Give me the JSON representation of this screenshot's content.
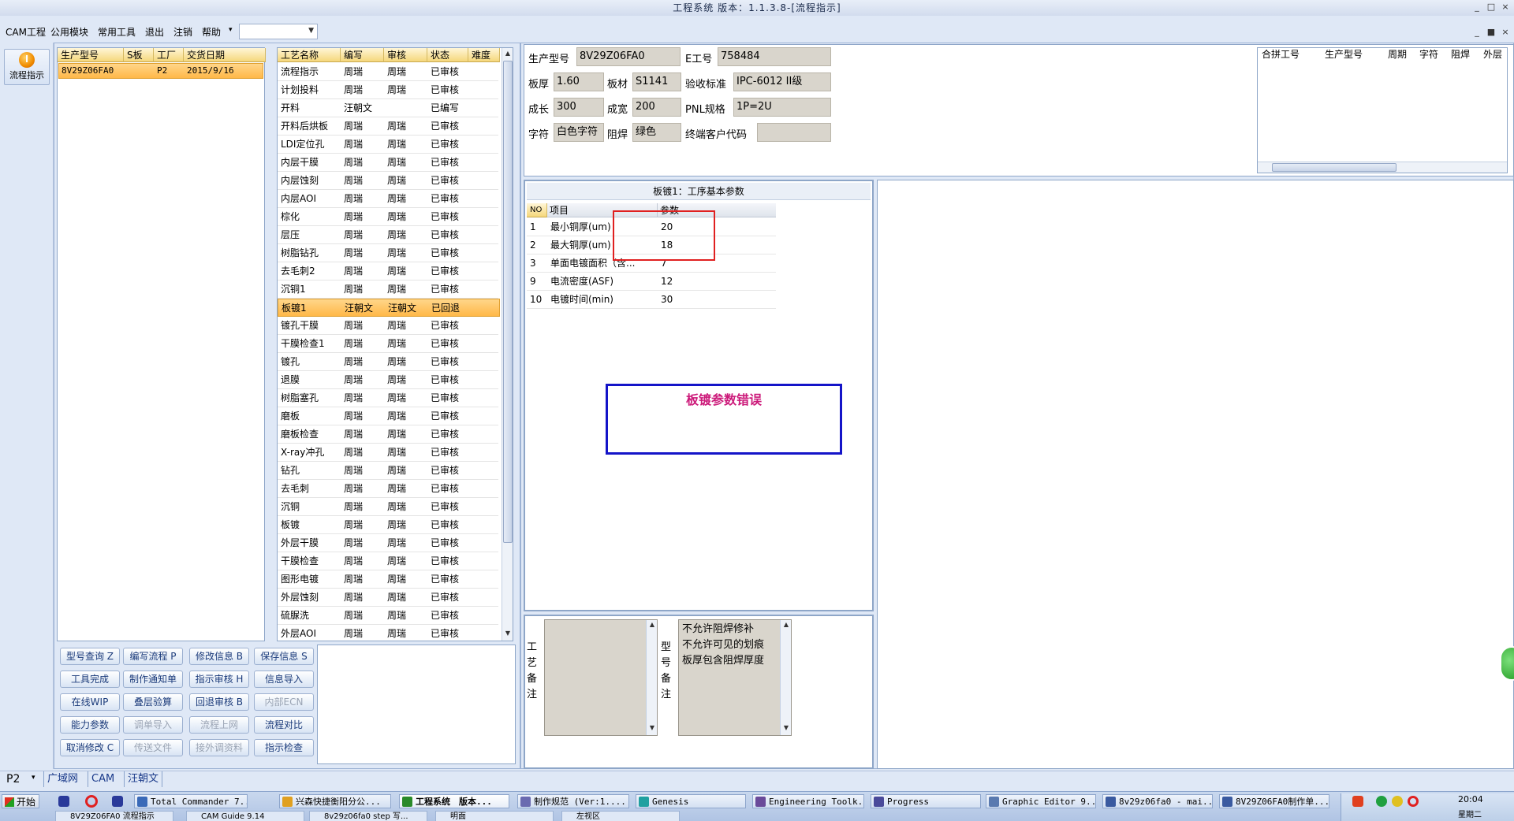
{
  "window": {
    "title": "工程系统 版本：1.1.3.8-[流程指示]",
    "controls": [
      "_",
      "□",
      "×"
    ],
    "mdi_controls": [
      "_",
      "■",
      "×"
    ]
  },
  "menu": {
    "items": [
      "CAM工程",
      "公用模块",
      "常用工具",
      "退出",
      "注销",
      "帮助"
    ],
    "help_arrow": "▾",
    "combo_value": ""
  },
  "left_strip": {
    "flow_button": "流程指示"
  },
  "model_list": {
    "headers": [
      "生产型号",
      "S板",
      "工厂",
      "交货日期"
    ],
    "rows": [
      {
        "model": "8V29Z06FA0",
        "s": "",
        "factory": "P2",
        "date": "2015/9/16"
      }
    ]
  },
  "process_list": {
    "headers": [
      "工艺名称",
      "编写",
      "审核",
      "状态",
      "难度"
    ],
    "rows": [
      [
        "流程指示",
        "周瑞",
        "周瑞",
        "已审核"
      ],
      [
        "计划投料",
        "周瑞",
        "周瑞",
        "已审核"
      ],
      [
        "开料",
        "汪朝文",
        "",
        "已编写"
      ],
      [
        "开料后烘板",
        "周瑞",
        "周瑞",
        "已审核"
      ],
      [
        "LDI定位孔",
        "周瑞",
        "周瑞",
        "已审核"
      ],
      [
        "内层干膜",
        "周瑞",
        "周瑞",
        "已审核"
      ],
      [
        "内层蚀刻",
        "周瑞",
        "周瑞",
        "已审核"
      ],
      [
        "内层AOI",
        "周瑞",
        "周瑞",
        "已审核"
      ],
      [
        "棕化",
        "周瑞",
        "周瑞",
        "已审核"
      ],
      [
        "层压",
        "周瑞",
        "周瑞",
        "已审核"
      ],
      [
        "树脂钻孔",
        "周瑞",
        "周瑞",
        "已审核"
      ],
      [
        "去毛刺2",
        "周瑞",
        "周瑞",
        "已审核"
      ],
      [
        "沉铜1",
        "周瑞",
        "周瑞",
        "已审核"
      ],
      [
        "板镀1",
        "汪朝文",
        "汪朝文",
        "已回退"
      ],
      [
        "镀孔干膜",
        "周瑞",
        "周瑞",
        "已审核"
      ],
      [
        "干膜检查1",
        "周瑞",
        "周瑞",
        "已审核"
      ],
      [
        "镀孔",
        "周瑞",
        "周瑞",
        "已审核"
      ],
      [
        "退膜",
        "周瑞",
        "周瑞",
        "已审核"
      ],
      [
        "树脂塞孔",
        "周瑞",
        "周瑞",
        "已审核"
      ],
      [
        "磨板",
        "周瑞",
        "周瑞",
        "已审核"
      ],
      [
        "磨板检查",
        "周瑞",
        "周瑞",
        "已审核"
      ],
      [
        "X-ray冲孔",
        "周瑞",
        "周瑞",
        "已审核"
      ],
      [
        "钻孔",
        "周瑞",
        "周瑞",
        "已审核"
      ],
      [
        "去毛刺",
        "周瑞",
        "周瑞",
        "已审核"
      ],
      [
        "沉铜",
        "周瑞",
        "周瑞",
        "已审核"
      ],
      [
        "板镀",
        "周瑞",
        "周瑞",
        "已审核"
      ],
      [
        "外层干膜",
        "周瑞",
        "周瑞",
        "已审核"
      ],
      [
        "干膜检查",
        "周瑞",
        "周瑞",
        "已审核"
      ],
      [
        "图形电镀",
        "周瑞",
        "周瑞",
        "已审核"
      ],
      [
        "外层蚀刻",
        "周瑞",
        "周瑞",
        "已审核"
      ],
      [
        "硫脲洗",
        "周瑞",
        "周瑞",
        "已审核"
      ],
      [
        "外层AOI",
        "周瑞",
        "周瑞",
        "已审核"
      ]
    ],
    "selected_index": 13
  },
  "buttons": [
    [
      {
        "label": "型号查询 Z",
        "enabled": true
      },
      {
        "label": "编写流程 P",
        "enabled": true
      },
      {
        "label": "修改信息 B",
        "enabled": true
      },
      {
        "label": "保存信息 S",
        "enabled": true
      }
    ],
    [
      {
        "label": "工具完成",
        "enabled": true
      },
      {
        "label": "制作通知单",
        "enabled": true
      },
      {
        "label": "指示审核 H",
        "enabled": true
      },
      {
        "label": "信息导入",
        "enabled": true
      }
    ],
    [
      {
        "label": "在线WIP",
        "enabled": true
      },
      {
        "label": "叠层验算",
        "enabled": true
      },
      {
        "label": "回退审核 B",
        "enabled": true
      },
      {
        "label": "内部ECN",
        "enabled": false
      }
    ],
    [
      {
        "label": "能力参数",
        "enabled": true
      },
      {
        "label": "调单导入",
        "enabled": false
      },
      {
        "label": "流程上网",
        "enabled": false
      },
      {
        "label": "流程对比",
        "enabled": true
      }
    ],
    [
      {
        "label": "取消修改 C",
        "enabled": true
      },
      {
        "label": "传送文件",
        "enabled": false
      },
      {
        "label": "接外调资料",
        "enabled": false
      },
      {
        "label": "指示检查",
        "enabled": true
      }
    ]
  ],
  "info": {
    "model_label": "生产型号",
    "model": "8V29Z06FA0",
    "eno_label": "E工号",
    "eno": "758484",
    "thick_label": "板厚",
    "thick": "1.60",
    "material_label": "板材",
    "material": "S1141",
    "accept_label": "验收标准",
    "accept": "IPC-6012 II级",
    "len_label": "成长",
    "len": "300",
    "wid_label": "成宽",
    "wid": "200",
    "pnl_label": "PNL规格",
    "pnl": "1P=2U",
    "char_label": "字符",
    "char": "白色字符",
    "mask_label": "阻焊",
    "mask": "绿色",
    "customer_label": "终端客户代码",
    "customer": ""
  },
  "merge_table": {
    "headers": [
      "合拼工号",
      "生产型号",
      "周期",
      "字符",
      "阻焊",
      "外层"
    ]
  },
  "param_panel": {
    "title": "板镀1：工序基本参数",
    "headers": [
      "NO",
      "项目",
      "参数"
    ],
    "rows": [
      [
        "1",
        "最小铜厚(um)",
        "20"
      ],
      [
        "2",
        "最大铜厚(um)",
        "18"
      ],
      [
        "3",
        "单面电镀面积（含...",
        "7"
      ],
      [
        "9",
        "电流密度(ASF)",
        "12"
      ],
      [
        "10",
        "电镀时间(min)",
        "30"
      ]
    ],
    "error": "板镀参数错误",
    "error_color": "#cc1a7a"
  },
  "remarks": {
    "process_label": "工艺备注",
    "model_label": "型号备注",
    "model_notes": [
      "不允许阻焊修补",
      "不允许可见的划痕",
      "板厚包含阻焊厚度"
    ]
  },
  "statusbar": {
    "factory": "P2",
    "items": [
      "广域网",
      "CAM",
      "汪朝文"
    ]
  },
  "taskbar": {
    "start": "开始",
    "tasks": [
      "Total Commander 7...",
      "兴森快捷衡阳分公...",
      "工程系统　版本...",
      "制作规范 (Ver:1....",
      "Genesis",
      "Engineering Toolk...",
      "Progress",
      "Graphic Editor 9....",
      "8v29z06fa0 - mai...",
      "8V29Z06FA0制作单..."
    ],
    "tasks_row2": [
      "8V29Z06FA0 流程指示",
      "CAM Guide 9.14",
      "8v29z06fa0 step 写...",
      "明面",
      "左视区"
    ],
    "clock": "20:04",
    "clock_sub": "星期二"
  }
}
